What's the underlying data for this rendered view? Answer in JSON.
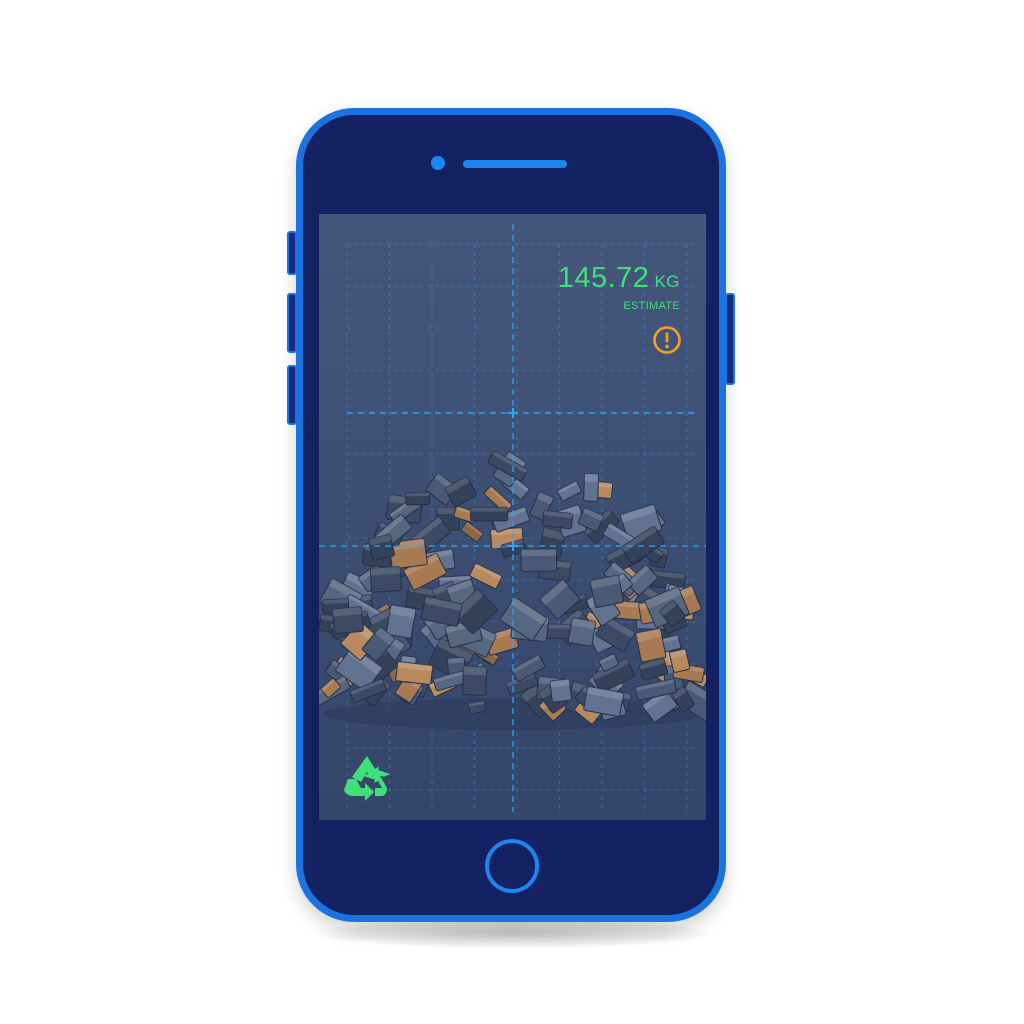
{
  "colors": {
    "phone_body": "#142264",
    "phone_frame": "#1a73e0",
    "grid_line": "#2aa6ff",
    "readout_green": "#3fe07a",
    "warning_orange": "#f2a024",
    "recycle_green": "#3fe07a",
    "scrap_steel": "#4a5a76",
    "scrap_copper": "#a97a52"
  },
  "scan": {
    "weight_value": "145.72",
    "weight_unit": "KG",
    "estimate_label": "ESTIMATE"
  },
  "icons": {
    "warning": "warning-icon",
    "recycle": "recycle-icon",
    "camera": "front-camera",
    "speaker": "earpiece-speaker",
    "home": "home-button"
  }
}
